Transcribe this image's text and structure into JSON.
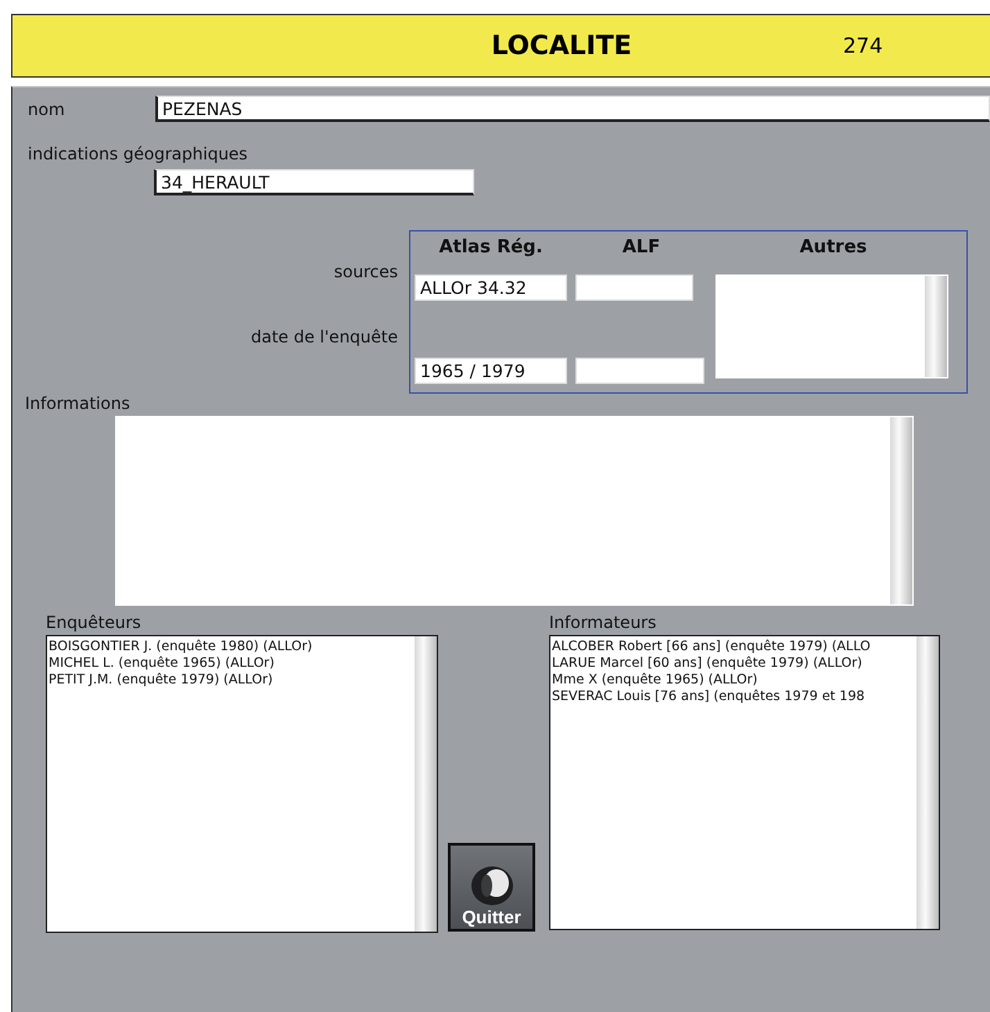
{
  "header": {
    "title": "LOCALITE",
    "number": "274"
  },
  "nom": {
    "label": "nom",
    "value": "PEZENAS"
  },
  "indications": {
    "label": "indications géographiques",
    "value": "34_HERAULT"
  },
  "sources": {
    "columns": [
      "Atlas Rég.",
      "ALF",
      "Autres"
    ],
    "rows": [
      {
        "label": "sources",
        "atlas": "ALLOr 34.32"
      },
      {
        "label": "date de l'enquête",
        "atlas": "1965 / 1979"
      }
    ]
  },
  "informations": {
    "label": "Informations"
  },
  "enqueteurs": {
    "label": "Enquêteurs",
    "items": [
      "BOISGONTIER J. (enquête 1980) (ALLOr)",
      "MICHEL L. (enquête 1965) (ALLOr)",
      "PETIT J.M. (enquête 1979) (ALLOr)"
    ]
  },
  "quit_button": {
    "label": "Quitter"
  },
  "informateurs": {
    "label": "Informateurs",
    "items": [
      "ALCOBER Robert [66 ans] (enquête 1979) (ALLO",
      "LARUE Marcel [60 ans] (enquête 1979) (ALLOr)",
      "Mme X (enquête 1965) (ALLOr)",
      "SEVERAC Louis [76 ans] (enquêtes 1979 et 198"
    ]
  }
}
